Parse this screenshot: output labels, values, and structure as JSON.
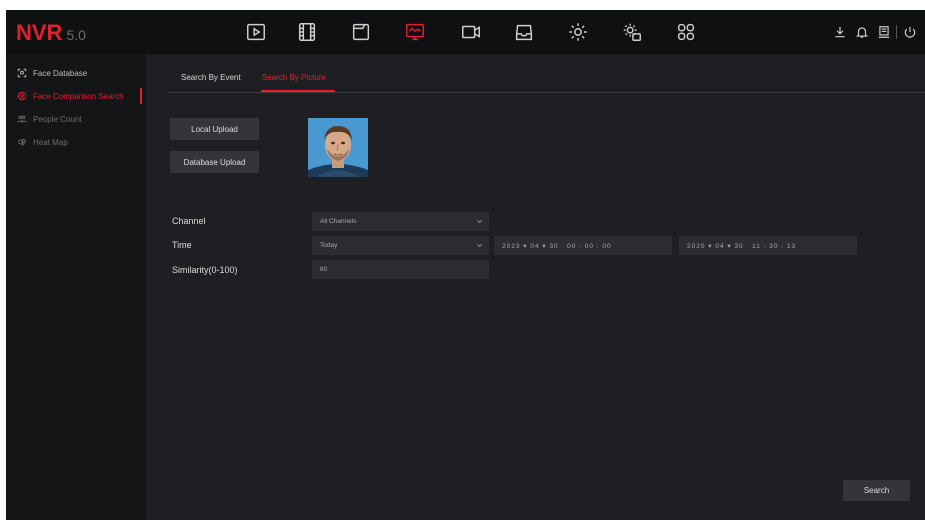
{
  "app": {
    "logo_text": "NVR",
    "logo_version": "5.0",
    "brand_color": "#e0202d"
  },
  "topnav": [
    {
      "name": "playback-icon",
      "active": false
    },
    {
      "name": "film-icon",
      "active": false
    },
    {
      "name": "folder-icon",
      "active": false
    },
    {
      "name": "monitor-icon",
      "active": true
    },
    {
      "name": "camera-icon",
      "active": false
    },
    {
      "name": "storage-icon",
      "active": false
    },
    {
      "name": "settings-icon",
      "active": false
    },
    {
      "name": "system-settings-icon",
      "active": false
    },
    {
      "name": "apps-grid-icon",
      "active": false
    }
  ],
  "topright": [
    "download-icon",
    "bell-icon",
    "display-icon",
    "power-icon"
  ],
  "sidebar": {
    "items": [
      {
        "label": "Face Database",
        "icon": "face-icon",
        "state": "normal"
      },
      {
        "label": "Face Comparison Search",
        "icon": "face-search-icon",
        "state": "active"
      },
      {
        "label": "People Count",
        "icon": "people-icon",
        "state": "dim"
      },
      {
        "label": "Heat Map",
        "icon": "heatmap-icon",
        "state": "dim"
      }
    ]
  },
  "tabs": [
    {
      "label": "Search By Event",
      "active": false
    },
    {
      "label": "Search By Picture",
      "active": true
    }
  ],
  "buttons": {
    "local_upload": "Local Upload",
    "database_upload": "Database Upload",
    "search": "Search"
  },
  "form": {
    "channel_label": "Channel",
    "channel_value": "All Channels",
    "time_label": "Time",
    "time_value": "Today",
    "start_datetime": "2023 ▾ 04 ▾ 30   00 : 00 : 00",
    "end_datetime": "2020 ▾ 04 ▾ 30   11 : 30 : 13",
    "similarity_label": "Similarity(0-100)",
    "similarity_value": "80"
  }
}
